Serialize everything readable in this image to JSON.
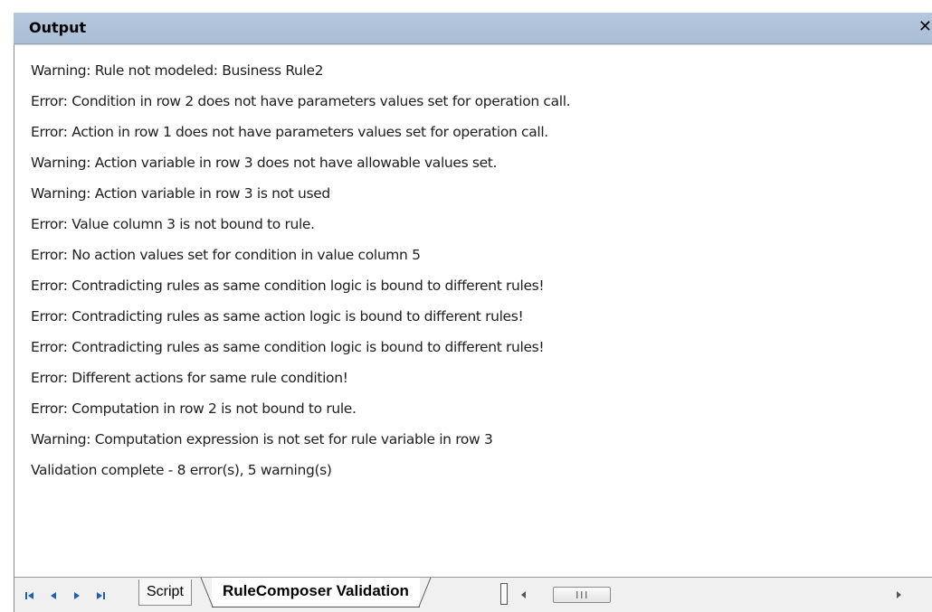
{
  "window": {
    "title": "Output",
    "close_glyph": "✕"
  },
  "output": {
    "lines": [
      "Warning: Rule not modeled: Business Rule2",
      "Error: Condition in row 2 does not have parameters values set for operation call.",
      "Error: Action in row 1 does not have parameters values set for operation call.",
      "Warning: Action variable in row 3 does not have allowable values set.",
      "Warning: Action variable in row 3 is not used",
      "Error: Value column 3 is not bound to rule.",
      "Error: No action values set for condition in value column 5",
      "Error: Contradicting rules as same condition logic is bound to different rules!",
      "Error: Contradicting rules as same action logic is bound to different rules!",
      "Error: Contradicting rules as same condition logic is bound to different rules!",
      "Error: Different actions for same rule condition!",
      "Error: Computation in row 2 is not bound to rule.",
      "Warning: Computation expression is not set for rule variable in row 3",
      "Validation complete - 8 error(s), 5 warning(s)"
    ]
  },
  "tabs": [
    {
      "label": "Script",
      "active": false
    },
    {
      "label": "RuleComposer Validation",
      "active": true
    }
  ],
  "icons": {
    "first": "first-tab-icon",
    "prev": "prev-tab-icon",
    "next": "next-tab-icon",
    "last": "last-tab-icon",
    "scroll_left": "scroll-left-icon",
    "scroll_right": "scroll-right-icon"
  },
  "colors": {
    "titlebar": "#adc1d9",
    "nav_blue": "#1f5fb5"
  }
}
